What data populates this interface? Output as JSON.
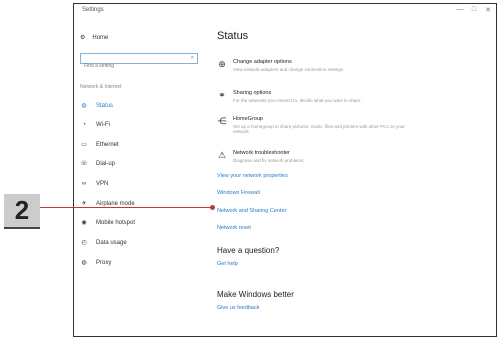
{
  "window": {
    "title": "Settings",
    "controls": [
      "—",
      "□",
      "✕"
    ]
  },
  "sidebar": {
    "home_label": "Home",
    "search_placeholder": "Find a setting",
    "section_label": "Network & Internet",
    "items": [
      {
        "label": "Status",
        "icon": "globe-icon"
      },
      {
        "label": "Wi-Fi",
        "icon": "wifi-icon"
      },
      {
        "label": "Ethernet",
        "icon": "ethernet-icon"
      },
      {
        "label": "Dial-up",
        "icon": "phone-icon"
      },
      {
        "label": "VPN",
        "icon": "vpn-icon"
      },
      {
        "label": "Airplane mode",
        "icon": "airplane-icon"
      },
      {
        "label": "Mobile hotspot",
        "icon": "hotspot-icon"
      },
      {
        "label": "Data usage",
        "icon": "data-usage-icon"
      },
      {
        "label": "Proxy",
        "icon": "globe-icon"
      }
    ]
  },
  "main": {
    "title": "Status",
    "options": [
      {
        "title": "Change adapter options",
        "desc": "View network adapters and change connection settings.",
        "icon": "adapter-icon"
      },
      {
        "title": "Sharing options",
        "desc": "For the networks you connect to, decide what you want to share.",
        "icon": "sharing-icon"
      },
      {
        "title": "HomeGroup",
        "desc": "Set up a homegroup to share pictures, music, files and printers with other PCs on your network.",
        "icon": "homegroup-icon"
      },
      {
        "title": "Network troubleshooter",
        "desc": "Diagnose and fix network problems.",
        "icon": "warning-icon"
      }
    ],
    "links": [
      "View your network properties",
      "Windows Firewall",
      "Network and Sharing Center",
      "Network reset"
    ],
    "question_heading": "Have a question?",
    "question_link": "Get help",
    "better_heading": "Make Windows better",
    "better_link": "Give us feedback"
  },
  "callout": {
    "number": "2",
    "color": "#c0392b"
  }
}
